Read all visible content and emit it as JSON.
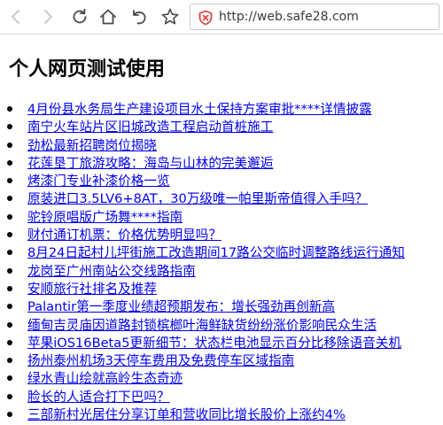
{
  "browser": {
    "url": "http://web.safe28.com",
    "icons": {
      "back": "arrow-left-icon",
      "forward": "arrow-right-icon",
      "reload": "reload-icon",
      "home": "home-icon",
      "undo": "undo-icon",
      "bookmark": "star-icon",
      "security": "not-secure-shield-icon"
    },
    "colors": {
      "security_warning": "#e03c3c",
      "link": "#0000ee"
    }
  },
  "page": {
    "title": "个人网页测试使用",
    "links": [
      {
        "text": "4月份县水务局生产建设项目水土保持方案审批****详情披露"
      },
      {
        "text": "南宁火车站片区旧城改造工程启动首桩施工"
      },
      {
        "text": "劲松最新招聘岗位揭晓"
      },
      {
        "text": "花莲垦丁旅游攻略：海岛与山林的完美邂逅"
      },
      {
        "text": "烤漆门专业补漆价格一览"
      },
      {
        "text": "原装进口3.5LV6+8AT，30万级唯一帕里斯帝值得入手吗？"
      },
      {
        "text": "驼铃原唱版广场舞****指南"
      },
      {
        "text": "财付通订机票：价格优势明显吗？"
      },
      {
        "text": "8月24日起村儿坪街施工改造期间17路公交临时调整路线运行通知"
      },
      {
        "text": "龙岗至广州南站公交线路指南"
      },
      {
        "text": "安顺旅行社排名及推荐"
      },
      {
        "text": "Palantir第一季度业绩超预期发布：增长强劲再创新高"
      },
      {
        "text": "缅甸吉灵庙因道路封锁槟榔叶海鲜缺货纷纷涨价影响民众生活"
      },
      {
        "text": "苹果iOS16Beta5更新细节：状态栏电池显示百分比移除语音关机"
      },
      {
        "text": "扬州泰州机场3天停车费用及免费停车区域指南"
      },
      {
        "text": "绿水青山绘就高岭生态奇迹"
      },
      {
        "text": "脸长的人适合打下巴吗？"
      },
      {
        "text": "三部新村光居住分享订单和营收同比增长股价上涨约4%"
      }
    ]
  }
}
